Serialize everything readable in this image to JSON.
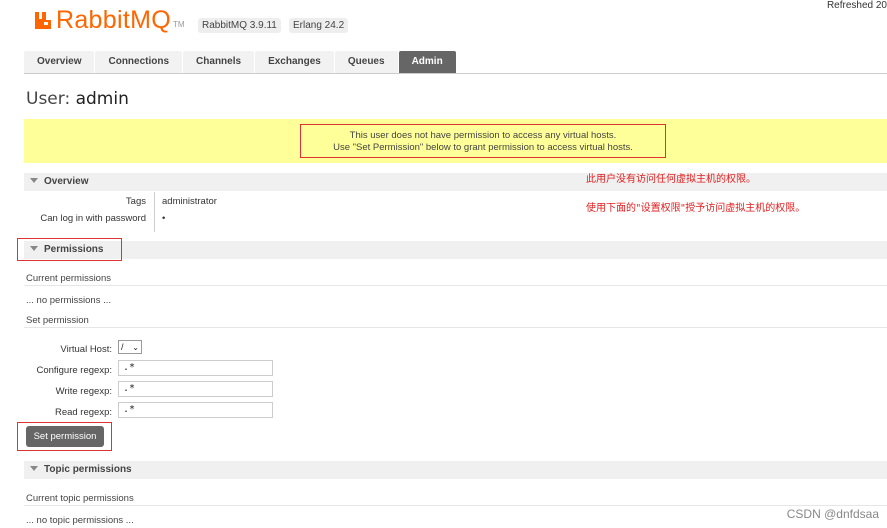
{
  "header": {
    "logo_text": "RabbitMQ",
    "logo_tm": "TM",
    "rabbitmq_version": "RabbitMQ 3.9.11",
    "erlang_version": "Erlang 24.2",
    "refreshed": "Refreshed 20"
  },
  "nav": {
    "tabs": [
      {
        "label": "Overview"
      },
      {
        "label": "Connections"
      },
      {
        "label": "Channels"
      },
      {
        "label": "Exchanges"
      },
      {
        "label": "Queues"
      },
      {
        "label": "Admin"
      }
    ],
    "active": "Admin"
  },
  "page": {
    "title_prefix": "User:",
    "title_user": "admin"
  },
  "warning": {
    "line1": "This user does not have permission to access any virtual hosts.",
    "line2": "Use \"Set Permission\" below to grant permission to access virtual hosts."
  },
  "annotations": {
    "zh_line1": "此用户没有访问任何虚拟主机的权限。",
    "zh_line2": "使用下面的\"设置权限\"授予访问虚拟主机的权限。"
  },
  "overview": {
    "heading": "Overview",
    "tags_label": "Tags",
    "tags_value": "administrator",
    "login_label": "Can log in with password",
    "login_value": "•"
  },
  "permissions": {
    "heading": "Permissions",
    "current_label": "Current permissions",
    "current_empty": "... no permissions ...",
    "set_label": "Set permission",
    "vhost_label": "Virtual Host:",
    "vhost_value": "/",
    "configure_label": "Configure regexp:",
    "configure_value": ".*",
    "write_label": "Write regexp:",
    "write_value": ".*",
    "read_label": "Read regexp:",
    "read_value": ".*",
    "button_label": "Set permission"
  },
  "topic": {
    "heading": "Topic permissions",
    "current_label": "Current topic permissions",
    "current_empty": "... no topic permissions ..."
  },
  "watermark": "CSDN @dnfdsaa",
  "colors": {
    "brand": "#ff6600",
    "active_tab": "#666666",
    "warning_bg": "#ffff99",
    "annotation_red": "#e02020"
  }
}
